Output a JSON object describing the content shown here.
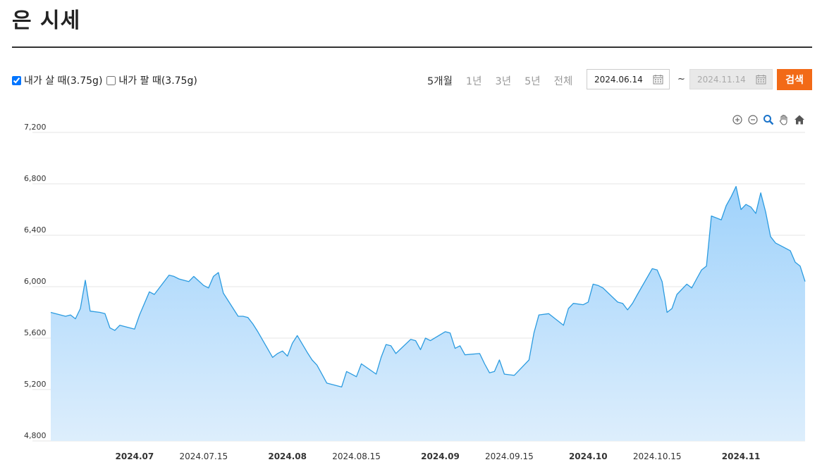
{
  "page": {
    "title": "은 시세"
  },
  "options": {
    "buy": {
      "label": "내가 살 때(3.75g)",
      "checked": true
    },
    "sell": {
      "label": "내가 팔 때(3.75g)",
      "checked": false
    }
  },
  "periods": [
    "5개월",
    "1년",
    "3년",
    "5년",
    "전체"
  ],
  "active_period": "5개월",
  "date_range": {
    "start": "2024.06.14",
    "end": "2024.11.14",
    "separator": "~"
  },
  "search_label": "검색",
  "toolbar_icons": [
    "zoom-in-icon",
    "zoom-out-icon",
    "magnifier-icon",
    "pan-hand-icon",
    "home-icon"
  ],
  "colors": {
    "line": "#2b9be0",
    "fill_top": "#9fd2fb",
    "fill_bottom": "#ddeefc",
    "accent": "#f26a17"
  },
  "chart_data": {
    "type": "area",
    "title": "",
    "xlabel": "",
    "ylabel": "",
    "ylim": [
      4800,
      7200
    ],
    "yticks": [
      "7,200",
      "6,800",
      "6,400",
      "6,000",
      "5,600",
      "5,200",
      "4,800"
    ],
    "xlim": [
      "2024-06-14",
      "2024-11-14"
    ],
    "xticks": [
      {
        "date": "2024-07-01",
        "label": "2024.07",
        "bold": true
      },
      {
        "date": "2024-07-15",
        "label": "2024.07.15",
        "bold": false
      },
      {
        "date": "2024-08-01",
        "label": "2024.08",
        "bold": true
      },
      {
        "date": "2024-08-15",
        "label": "2024.08.15",
        "bold": false
      },
      {
        "date": "2024-09-01",
        "label": "2024.09",
        "bold": true
      },
      {
        "date": "2024-09-15",
        "label": "2024.09.15",
        "bold": false
      },
      {
        "date": "2024-10-01",
        "label": "2024.10",
        "bold": true
      },
      {
        "date": "2024-10-15",
        "label": "2024.10.15",
        "bold": false
      },
      {
        "date": "2024-11-01",
        "label": "2024.11",
        "bold": true
      }
    ],
    "grid": true,
    "series": [
      {
        "points": [
          [
            "2024-06-14",
            5800
          ],
          [
            "2024-06-17",
            5770
          ],
          [
            "2024-06-18",
            5780
          ],
          [
            "2024-06-19",
            5750
          ],
          [
            "2024-06-20",
            5830
          ],
          [
            "2024-06-21",
            6050
          ],
          [
            "2024-06-22",
            5810
          ],
          [
            "2024-06-24",
            5800
          ],
          [
            "2024-06-25",
            5790
          ],
          [
            "2024-06-26",
            5680
          ],
          [
            "2024-06-27",
            5660
          ],
          [
            "2024-06-28",
            5700
          ],
          [
            "2024-07-01",
            5670
          ],
          [
            "2024-07-02",
            5780
          ],
          [
            "2024-07-03",
            5870
          ],
          [
            "2024-07-04",
            5960
          ],
          [
            "2024-07-05",
            5940
          ],
          [
            "2024-07-08",
            6090
          ],
          [
            "2024-07-09",
            6080
          ],
          [
            "2024-07-10",
            6060
          ],
          [
            "2024-07-11",
            6050
          ],
          [
            "2024-07-12",
            6040
          ],
          [
            "2024-07-13",
            6080
          ],
          [
            "2024-07-15",
            6010
          ],
          [
            "2024-07-16",
            5990
          ],
          [
            "2024-07-17",
            6080
          ],
          [
            "2024-07-18",
            6110
          ],
          [
            "2024-07-19",
            5950
          ],
          [
            "2024-07-22",
            5770
          ],
          [
            "2024-07-23",
            5770
          ],
          [
            "2024-07-24",
            5760
          ],
          [
            "2024-07-25",
            5710
          ],
          [
            "2024-07-26",
            5650
          ],
          [
            "2024-07-29",
            5450
          ],
          [
            "2024-07-30",
            5480
          ],
          [
            "2024-07-31",
            5500
          ],
          [
            "2024-08-01",
            5460
          ],
          [
            "2024-08-02",
            5560
          ],
          [
            "2024-08-03",
            5620
          ],
          [
            "2024-08-05",
            5490
          ],
          [
            "2024-08-06",
            5430
          ],
          [
            "2024-08-07",
            5390
          ],
          [
            "2024-08-08",
            5320
          ],
          [
            "2024-08-09",
            5250
          ],
          [
            "2024-08-12",
            5220
          ],
          [
            "2024-08-13",
            5340
          ],
          [
            "2024-08-14",
            5320
          ],
          [
            "2024-08-15",
            5300
          ],
          [
            "2024-08-16",
            5400
          ],
          [
            "2024-08-19",
            5320
          ],
          [
            "2024-08-20",
            5450
          ],
          [
            "2024-08-21",
            5550
          ],
          [
            "2024-08-22",
            5540
          ],
          [
            "2024-08-23",
            5480
          ],
          [
            "2024-08-26",
            5590
          ],
          [
            "2024-08-27",
            5580
          ],
          [
            "2024-08-28",
            5510
          ],
          [
            "2024-08-29",
            5600
          ],
          [
            "2024-08-30",
            5580
          ],
          [
            "2024-09-02",
            5650
          ],
          [
            "2024-09-03",
            5640
          ],
          [
            "2024-09-04",
            5520
          ],
          [
            "2024-09-05",
            5540
          ],
          [
            "2024-09-06",
            5470
          ],
          [
            "2024-09-09",
            5480
          ],
          [
            "2024-09-10",
            5400
          ],
          [
            "2024-09-11",
            5330
          ],
          [
            "2024-09-12",
            5340
          ],
          [
            "2024-09-13",
            5430
          ],
          [
            "2024-09-14",
            5320
          ],
          [
            "2024-09-16",
            5310
          ],
          [
            "2024-09-18",
            5390
          ],
          [
            "2024-09-19",
            5430
          ],
          [
            "2024-09-20",
            5640
          ],
          [
            "2024-09-21",
            5780
          ],
          [
            "2024-09-23",
            5790
          ],
          [
            "2024-09-24",
            5760
          ],
          [
            "2024-09-25",
            5730
          ],
          [
            "2024-09-26",
            5700
          ],
          [
            "2024-09-27",
            5830
          ],
          [
            "2024-09-28",
            5870
          ],
          [
            "2024-09-30",
            5860
          ],
          [
            "2024-10-01",
            5880
          ],
          [
            "2024-10-02",
            6020
          ],
          [
            "2024-10-03",
            6010
          ],
          [
            "2024-10-04",
            5990
          ],
          [
            "2024-10-07",
            5880
          ],
          [
            "2024-10-08",
            5870
          ],
          [
            "2024-10-09",
            5820
          ],
          [
            "2024-10-10",
            5870
          ],
          [
            "2024-10-11",
            5940
          ],
          [
            "2024-10-14",
            6140
          ],
          [
            "2024-10-15",
            6130
          ],
          [
            "2024-10-16",
            6040
          ],
          [
            "2024-10-17",
            5800
          ],
          [
            "2024-10-18",
            5830
          ],
          [
            "2024-10-19",
            5940
          ],
          [
            "2024-10-21",
            6020
          ],
          [
            "2024-10-22",
            5990
          ],
          [
            "2024-10-23",
            6060
          ],
          [
            "2024-10-24",
            6130
          ],
          [
            "2024-10-25",
            6160
          ],
          [
            "2024-10-26",
            6550
          ],
          [
            "2024-10-28",
            6520
          ],
          [
            "2024-10-29",
            6630
          ],
          [
            "2024-10-30",
            6700
          ],
          [
            "2024-10-31",
            6780
          ],
          [
            "2024-11-01",
            6600
          ],
          [
            "2024-11-02",
            6640
          ],
          [
            "2024-11-03",
            6620
          ],
          [
            "2024-11-04",
            6570
          ],
          [
            "2024-11-05",
            6730
          ],
          [
            "2024-11-06",
            6580
          ],
          [
            "2024-11-07",
            6390
          ],
          [
            "2024-11-08",
            6340
          ],
          [
            "2024-11-09",
            6320
          ],
          [
            "2024-11-11",
            6280
          ],
          [
            "2024-11-12",
            6190
          ],
          [
            "2024-11-13",
            6160
          ],
          [
            "2024-11-14",
            6040
          ]
        ]
      }
    ]
  }
}
